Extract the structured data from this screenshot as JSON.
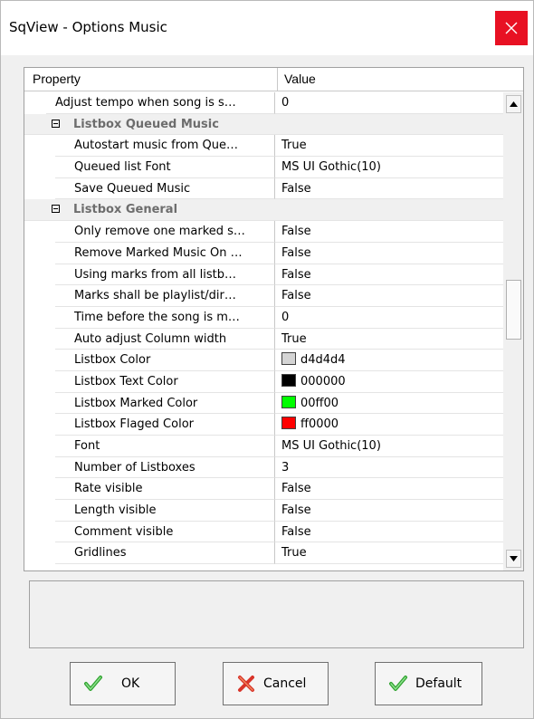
{
  "window": {
    "title": "SqView - Options Music"
  },
  "grid": {
    "header": {
      "property": "Property",
      "value": "Value"
    },
    "top_row": {
      "property": "Adjust tempo when song is s…",
      "value": "0"
    },
    "categories": [
      {
        "label": "Listbox Queued Music",
        "rows": [
          {
            "property": "Autostart music from Que…",
            "value": "True"
          },
          {
            "property": "Queued list Font",
            "value": "MS UI Gothic(10)"
          },
          {
            "property": "Save Queued Music",
            "value": "False"
          }
        ]
      },
      {
        "label": "Listbox General",
        "rows": [
          {
            "property": "Only remove one marked s…",
            "value": "False"
          },
          {
            "property": "Remove Marked Music On …",
            "value": "False"
          },
          {
            "property": "Using marks from all listb…",
            "value": "False"
          },
          {
            "property": "Marks shall be playlist/dir…",
            "value": "False"
          },
          {
            "property": "Time before the song is m…",
            "value": "0"
          },
          {
            "property": "Auto adjust Column width",
            "value": "True"
          },
          {
            "property": "Listbox Color",
            "value": "d4d4d4",
            "swatch": "#d4d4d4"
          },
          {
            "property": "Listbox Text Color",
            "value": "000000",
            "swatch": "#000000"
          },
          {
            "property": "Listbox Marked Color",
            "value": "00ff00",
            "swatch": "#00ff00"
          },
          {
            "property": "Listbox Flaged Color",
            "value": "ff0000",
            "swatch": "#ff0000"
          },
          {
            "property": "Font",
            "value": "MS UI Gothic(10)"
          },
          {
            "property": "Number of Listboxes",
            "value": "3"
          },
          {
            "property": "Rate visible",
            "value": "False"
          },
          {
            "property": "Length visible",
            "value": "False"
          },
          {
            "property": "Comment visible",
            "value": "False"
          },
          {
            "property": "Gridlines",
            "value": "True"
          }
        ]
      }
    ]
  },
  "buttons": {
    "ok": "OK",
    "cancel": "Cancel",
    "default": "Default"
  },
  "icons": {
    "close": "close-icon",
    "ok": "green-check-icon",
    "cancel": "red-x-icon",
    "default": "green-check-icon"
  },
  "colors": {
    "close_bg": "#e81123",
    "category_text": "#6d6d6d"
  }
}
